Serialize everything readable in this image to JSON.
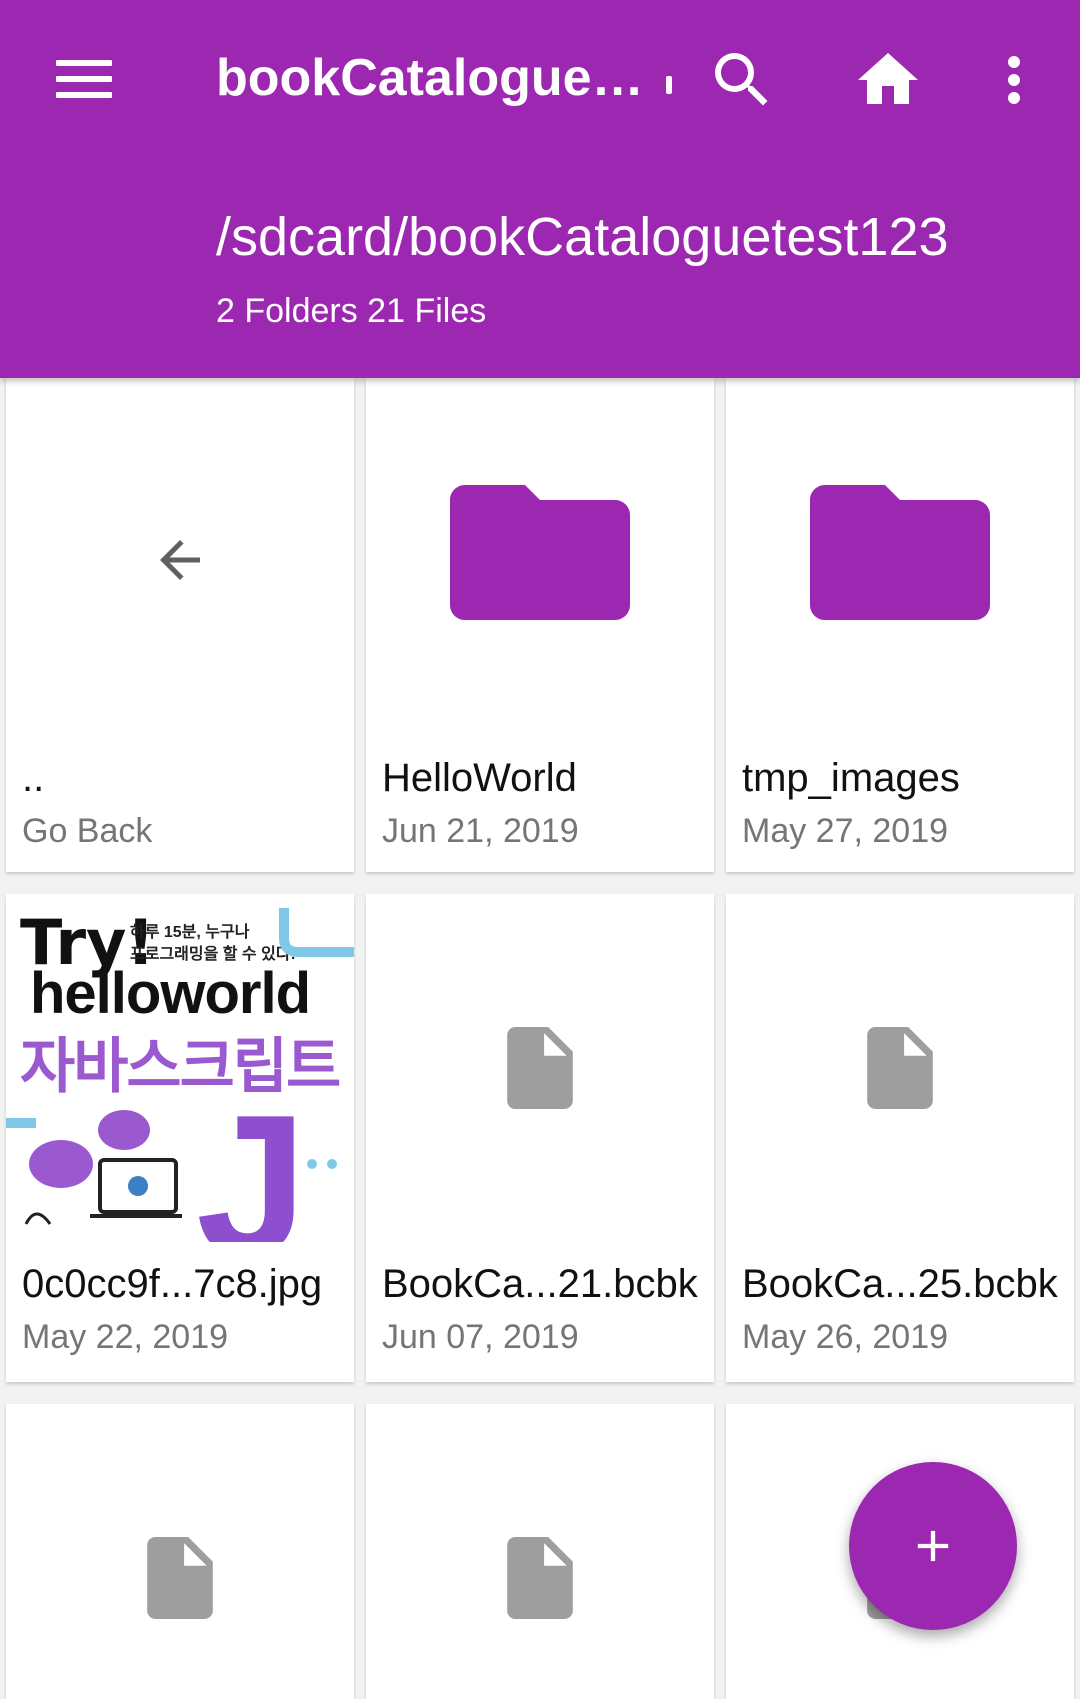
{
  "toolbar": {
    "title": "bookCataloguet...",
    "menu_icon": "menu-icon",
    "search_icon": "search-icon",
    "home_icon": "home-icon",
    "more_icon": "more-vert-icon"
  },
  "location": {
    "path": "/sdcard/bookCataloguetest123",
    "summary": "2 Folders 21 Files"
  },
  "items": [
    {
      "name": "..",
      "sub": "Go Back",
      "icon": "arrow-back-icon"
    },
    {
      "name": "HelloWorld",
      "sub": "Jun 21, 2019",
      "icon": "folder-icon"
    },
    {
      "name": "tmp_images",
      "sub": "May 27, 2019",
      "icon": "folder-icon"
    },
    {
      "name": "0c0cc9f...7c8.jpg",
      "sub": "May 22, 2019",
      "icon": "image-thumbnail"
    },
    {
      "name": "BookCa...21.bcbk",
      "sub": "Jun 07, 2019",
      "icon": "file-icon"
    },
    {
      "name": "BookCa...25.bcbk",
      "sub": "May 26, 2019",
      "icon": "file-icon"
    },
    {
      "name": "",
      "sub": "",
      "icon": "file-icon"
    },
    {
      "name": "",
      "sub": "",
      "icon": "file-icon"
    },
    {
      "name": "",
      "sub": "",
      "icon": "file-icon"
    }
  ],
  "thumbnail_cover": {
    "line1": "Try!",
    "line2": "하루 15분, 누구나",
    "line3": "프로그래밍을 할 수 있다!",
    "line4": "helloworld",
    "line5": "자바스크립트",
    "line6": "J"
  },
  "fab": {
    "icon": "add-icon"
  },
  "colors": {
    "primary": "#9c27b0",
    "file_icon": "#9e9e9e",
    "secondary_text": "#757575"
  }
}
